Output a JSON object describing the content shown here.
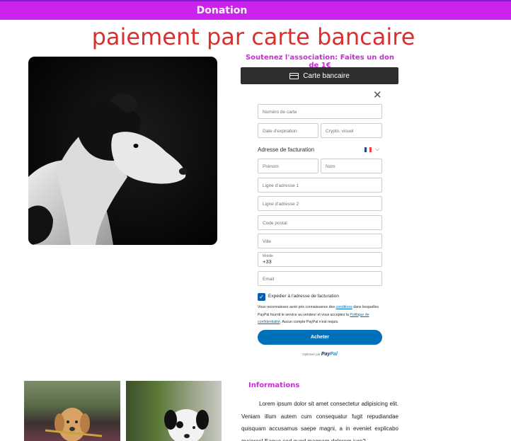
{
  "header": {
    "title": "Donation",
    "bg_color": "#cc22ee"
  },
  "page_title": "paiement par carte bancaire",
  "support_text": "Soutenez l'association: Faites un don de 1€",
  "card_button": {
    "label": "Carte bancaire",
    "icon": "credit-card-icon"
  },
  "form": {
    "card_number_placeholder": "Numéro de carte",
    "expiry_placeholder": "Date d'expiration",
    "cvv_placeholder": "Crypto. visuel",
    "billing_label": "Adresse de facturation",
    "country_flag": "france-flag-icon",
    "first_name_placeholder": "Prénom",
    "last_name_placeholder": "Nom",
    "address1_placeholder": "Ligne d'adresse 1",
    "address2_placeholder": "Ligne d'adresse 2",
    "postal_placeholder": "Code postal",
    "city_placeholder": "Ville",
    "mobile_label": "Mobile",
    "mobile_value": "+33",
    "email_placeholder": "Email",
    "ship_checkbox_label": "Expédier à l'adresse de facturation",
    "ship_checked": true,
    "legal_part1": "Vous reconnaissez avoir pris connaissance des",
    "legal_link_conditions": "conditions",
    "legal_part2": "dans lesquelles PayPal fournit le service au vendeur et vous acceptez la",
    "legal_link_privacy": "Politique de confidentialité",
    "legal_part3": ". Aucun compte PayPal n'est requis.",
    "submit_label": "Acheter",
    "powered_text": "Optimisé par",
    "powered_brand_pay": "Pay",
    "powered_brand_pal": "Pal"
  },
  "info": {
    "title": "Informations",
    "text": "Lorem ipsum dolor sit amet consectetur adipisicing elit. Veniam illum autem cum consequatur fugit repudiandae quisquam accusamus saepe magni, a in eveniet explicabo maiores! Eaque sed quod magnam dolorem iure?"
  },
  "colors": {
    "accent": "#c62dd6",
    "title_red": "#d9302f",
    "paypal_blue": "#0070ba"
  }
}
